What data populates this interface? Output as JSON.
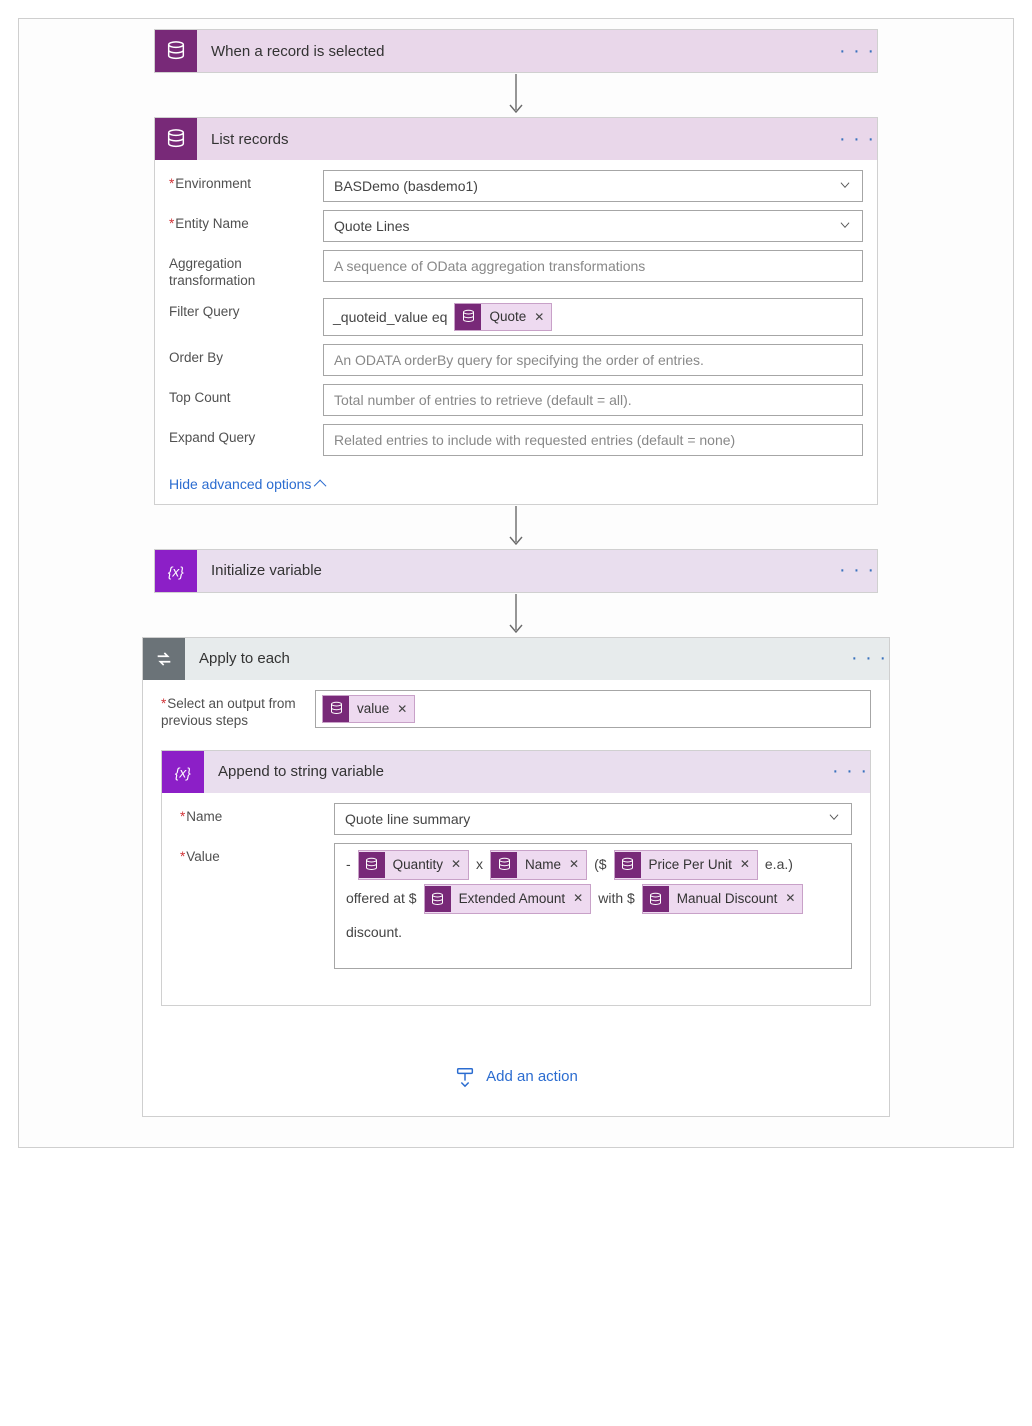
{
  "trigger": {
    "title": "When a record is selected"
  },
  "listRecords": {
    "title": "List records",
    "labels": {
      "environment": "Environment",
      "entityName": "Entity Name",
      "aggregation": "Aggregation transformation",
      "filterQuery": "Filter Query",
      "orderBy": "Order By",
      "topCount": "Top Count",
      "expandQuery": "Expand Query"
    },
    "values": {
      "environment": "BASDemo (basdemo1)",
      "entityName": "Quote Lines",
      "filterPrefix": "_quoteid_value eq",
      "filterToken": "Quote"
    },
    "placeholders": {
      "aggregation": "A sequence of OData aggregation transformations",
      "orderBy": "An ODATA orderBy query for specifying the order of entries.",
      "topCount": "Total number of entries to retrieve (default = all).",
      "expandQuery": "Related entries to include with requested entries (default = none)"
    },
    "hideLink": "Hide advanced options"
  },
  "initVar": {
    "title": "Initialize variable"
  },
  "applyEach": {
    "title": "Apply to each",
    "selectLabel": "Select an output from previous steps",
    "valueToken": "value",
    "addAction": "Add an action"
  },
  "append": {
    "title": "Append to string variable",
    "labels": {
      "name": "Name",
      "value": "Value"
    },
    "nameValue": "Quote line summary",
    "valTokens": {
      "quantity": "Quantity",
      "name": "Name",
      "pricePerUnit": "Price Per Unit",
      "extendedAmount": "Extended Amount",
      "manualDiscount": "Manual Discount"
    },
    "valText": {
      "dash": "-",
      "x": "x",
      "open": "($",
      "ea": "e.a.)",
      "offered": "offered at $",
      "with": "with $",
      "discount": "discount."
    }
  }
}
